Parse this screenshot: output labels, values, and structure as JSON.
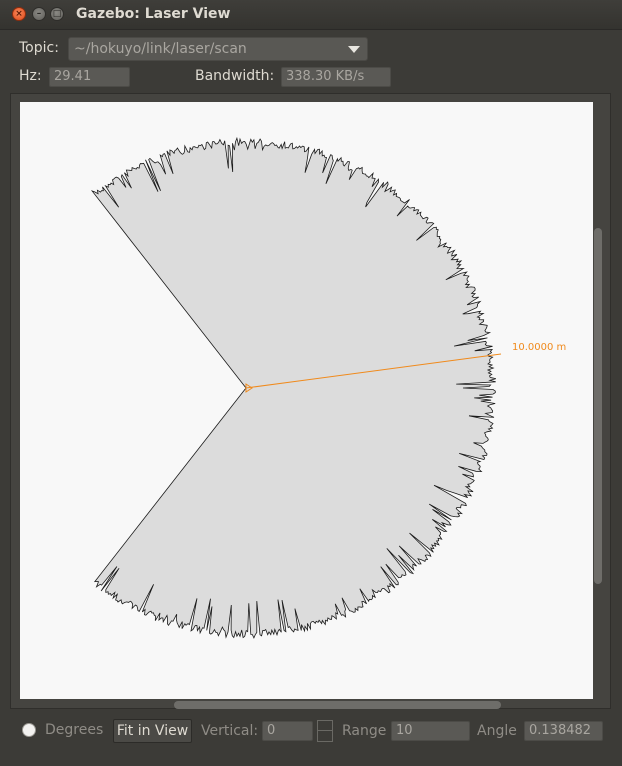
{
  "window": {
    "title": "Gazebo: Laser View"
  },
  "topic": {
    "label": "Topic:",
    "value": "~/hokuyo/link/laser/scan"
  },
  "stats": {
    "hz_label": "Hz:",
    "hz_value": "29.41",
    "bandwidth_label": "Bandwidth:",
    "bandwidth_value": "338.30 KB/s"
  },
  "view": {
    "range_text": "10.0000 m",
    "scan_fill": "#dcdcdc",
    "range_line_color": "#f08a1c"
  },
  "controls": {
    "degrees_label": "Degrees",
    "fit_label": "Fit in View",
    "vertical_label": "Vertical:",
    "vertical_value": "0",
    "range_label": "Range",
    "range_value": "10",
    "angle_label": "Angle",
    "angle_value": "0.138482"
  }
}
